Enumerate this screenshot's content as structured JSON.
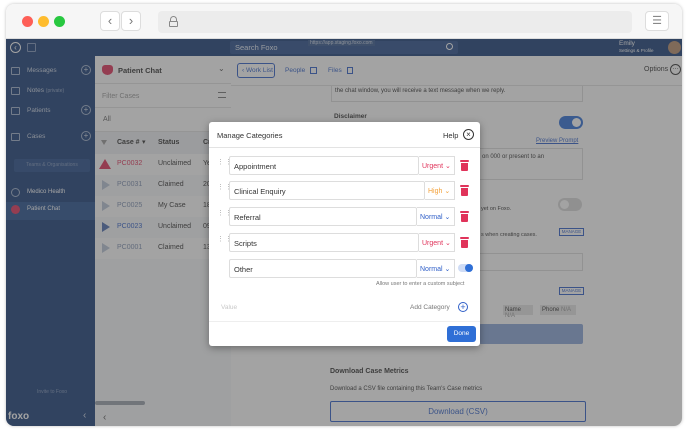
{
  "browser": {
    "url_hint": "https://app.staging.foxo.com"
  },
  "header": {
    "search_placeholder": "Search Foxo",
    "user_name": "Emily",
    "user_sub": "Settings & Profile"
  },
  "sidebar": {
    "items": [
      {
        "label": "Messages"
      },
      {
        "label": "Notes",
        "sub": "(private)"
      },
      {
        "label": "Patients"
      },
      {
        "label": "Cases"
      }
    ],
    "teams_label": "Teams & Organisations",
    "orgs": [
      {
        "label": "Medico Health"
      },
      {
        "label": "Patient Chat"
      }
    ],
    "invite_label": "Invite to Foxo",
    "logo": "foxo"
  },
  "middle": {
    "title": "Patient Chat",
    "filter_placeholder": "Filter Cases",
    "select_value": "All",
    "columns": [
      "Case #",
      "Status",
      "Cre"
    ],
    "rows": [
      {
        "case": "PC0032",
        "status": "Unclaimed",
        "created": "Yes"
      },
      {
        "case": "PC0031",
        "status": "Claimed",
        "created": "20"
      },
      {
        "case": "PC0025",
        "status": "My Case",
        "created": "18"
      },
      {
        "case": "PC0023",
        "status": "Unclaimed",
        "created": "09"
      },
      {
        "case": "PC0001",
        "status": "Claimed",
        "created": "13"
      }
    ]
  },
  "main": {
    "tabs": [
      {
        "label": "Work List"
      },
      {
        "label": "People"
      },
      {
        "label": "Files"
      }
    ],
    "options_label": "Options",
    "bg_text1": "the chat window, you will receive a text message when we reply.",
    "disclaimer_label": "Disclaimer",
    "preview_prompt": "Preview Prompt",
    "bg_text2": "on 000 or present to an",
    "bg_text3": "yet on Foxo.",
    "bg_text4": "s when creating cases.",
    "manage_label": "MANAGE",
    "name_tag": "Name",
    "phone_tag": "Phone",
    "metrics_title": "Download Case Metrics",
    "metrics_desc": "Download a CSV file containing this Team's Case metrics",
    "download_label": "Download (CSV)"
  },
  "modal": {
    "title": "Manage Categories",
    "help_label": "Help",
    "categories": [
      {
        "name": "Appointment",
        "priority": "Urgent"
      },
      {
        "name": "Clinical Enquiry",
        "priority": "High"
      },
      {
        "name": "Referral",
        "priority": "Normal"
      },
      {
        "name": "Scripts",
        "priority": "Urgent"
      }
    ],
    "other": {
      "name": "Other",
      "priority": "Normal",
      "toggle_on": true,
      "note": "Allow user to enter a custom subject"
    },
    "value_placeholder": "Value",
    "add_label": "Add Category",
    "done_label": "Done"
  },
  "colors": {
    "navy": "#1b3f78",
    "urgent": "#e0335a",
    "high": "#f3a13a",
    "normal": "#2f5fc8",
    "accent": "#2f6fd6"
  }
}
